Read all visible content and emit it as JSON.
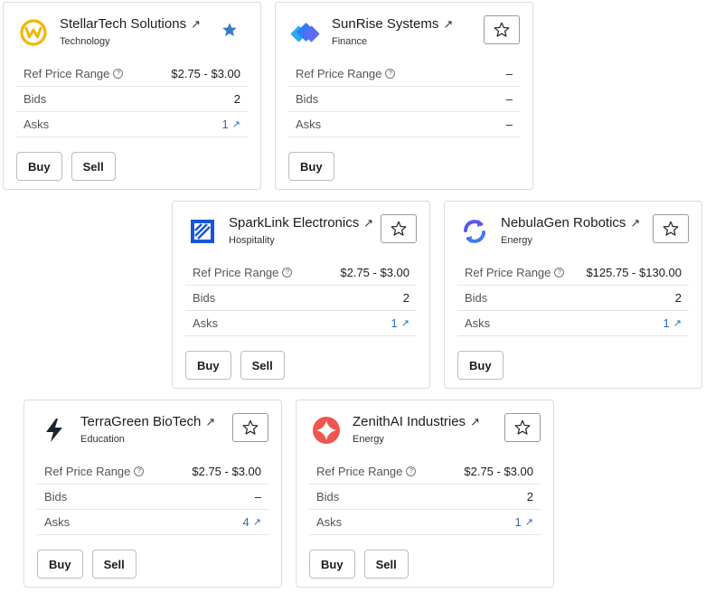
{
  "labels": {
    "ref_price_range": "Ref Price Range",
    "bids": "Bids",
    "asks": "Asks",
    "buy": "Buy",
    "sell": "Sell",
    "external_link_glyph": "↗"
  },
  "cards": [
    {
      "name": "StellarTech Solutions",
      "industry": "Technology",
      "ref_price_range": "$2.75 - $3.00",
      "bids": "2",
      "asks": "1",
      "asks_is_link": true,
      "favorited": true,
      "show_sell": true,
      "logo_icon": "yellow-wave-icon"
    },
    {
      "name": "SunRise Systems",
      "industry": "Finance",
      "ref_price_range": "–",
      "bids": "–",
      "asks": "–",
      "asks_is_link": false,
      "favorited": false,
      "show_sell": false,
      "logo_icon": "blue-diamond-stack-icon"
    },
    {
      "name": "SparkLink Electronics",
      "industry": "Hospitality",
      "ref_price_range": "$2.75 - $3.00",
      "bids": "2",
      "asks": "1",
      "asks_is_link": true,
      "favorited": false,
      "show_sell": true,
      "logo_icon": "blue-hatched-square-icon"
    },
    {
      "name": "NebulaGen Robotics",
      "industry": "Energy",
      "ref_price_range": "$125.75 - $130.00",
      "bids": "2",
      "asks": "1",
      "asks_is_link": true,
      "favorited": false,
      "show_sell": false,
      "logo_icon": "purple-cycle-arrows-icon"
    },
    {
      "name": "TerraGreen BioTech",
      "industry": "Education",
      "ref_price_range": "$2.75 - $3.00",
      "bids": "–",
      "asks": "4",
      "asks_is_link": true,
      "favorited": false,
      "show_sell": true,
      "logo_icon": "lightning-bolt-icon"
    },
    {
      "name": "ZenithAI Industries",
      "industry": "Energy",
      "ref_price_range": "$2.75 - $3.00",
      "bids": "2",
      "asks": "1",
      "asks_is_link": true,
      "favorited": false,
      "show_sell": true,
      "logo_icon": "red-sparkle-icon"
    }
  ],
  "colors": {
    "link": "#2a6ab5",
    "favorite_filled": "#3a7bc8",
    "stellartech_logo": "#f2b705",
    "sunrise_logo": "#2f7cf6",
    "sparklink_logo": "#1856d6",
    "nebulagen_logo": "#5b54f0",
    "terragreen_logo": "#1c2430",
    "zenithai_logo": "#f0554f"
  }
}
